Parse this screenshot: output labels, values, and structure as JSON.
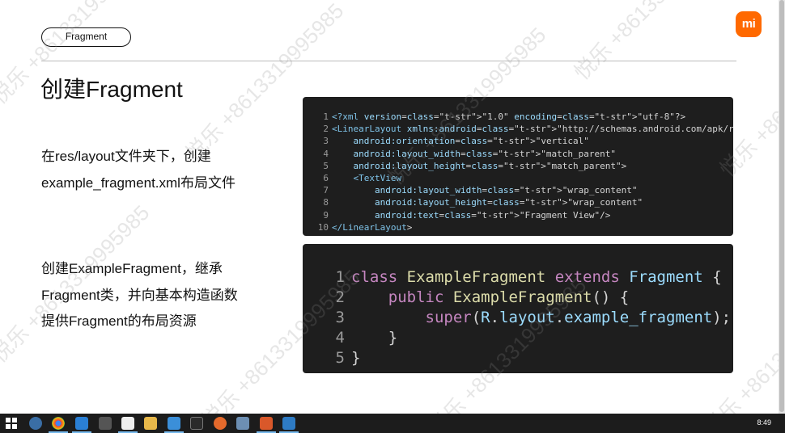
{
  "slide": {
    "tag_label": "Fragment",
    "logo_text": "mi",
    "title": "创建Fragment",
    "desc1_lines": [
      "在res/layout文件夹下，创建",
      "example_fragment.xml布局文件"
    ],
    "desc2_lines": [
      "创建ExampleFragment，继承",
      "Fragment类，并向基本构造函数",
      "提供Fragment的布局资源"
    ]
  },
  "code_xml": {
    "line_numbers": [
      "1",
      "2",
      "3",
      "4",
      "5",
      "6",
      "7",
      "8",
      "9",
      "10"
    ],
    "lines": [
      "<?xml version=\"1.0\" encoding=\"utf-8\"?>",
      "<LinearLayout xmlns:android=\"http://schemas.android.com/apk/res/android\"",
      "    android:orientation=\"vertical\"",
      "    android:layout_width=\"match_parent\"",
      "    android:layout_height=\"match_parent\">",
      "    <TextView",
      "        android:layout_width=\"wrap_content\"",
      "        android:layout_height=\"wrap_content\"",
      "        android:text=\"Fragment View\"/>",
      "</LinearLayout>"
    ]
  },
  "code_java": {
    "line_numbers": [
      "1",
      "2",
      "3",
      "4",
      "5"
    ],
    "lines": [
      "class ExampleFragment extends Fragment {",
      "    public ExampleFragment() {",
      "        super(R.layout.example_fragment);",
      "    }",
      "}"
    ]
  },
  "watermark": {
    "text": "悦乐 +8613319995985"
  },
  "taskbar": {
    "clock": "8:49",
    "icons": [
      "windows-start-icon",
      "chrome-icon",
      "browser-icon",
      "app-icon",
      "terminal-icon",
      "qq-icon",
      "folder-icon",
      "app-icon",
      "cmd-icon",
      "app-icon",
      "app-icon",
      "app-icon",
      "app-icon"
    ]
  },
  "colors": {
    "logo": "#ff6900",
    "code_bg": "#1e1e1e",
    "taskbar_bg": "#1c1c1c"
  }
}
